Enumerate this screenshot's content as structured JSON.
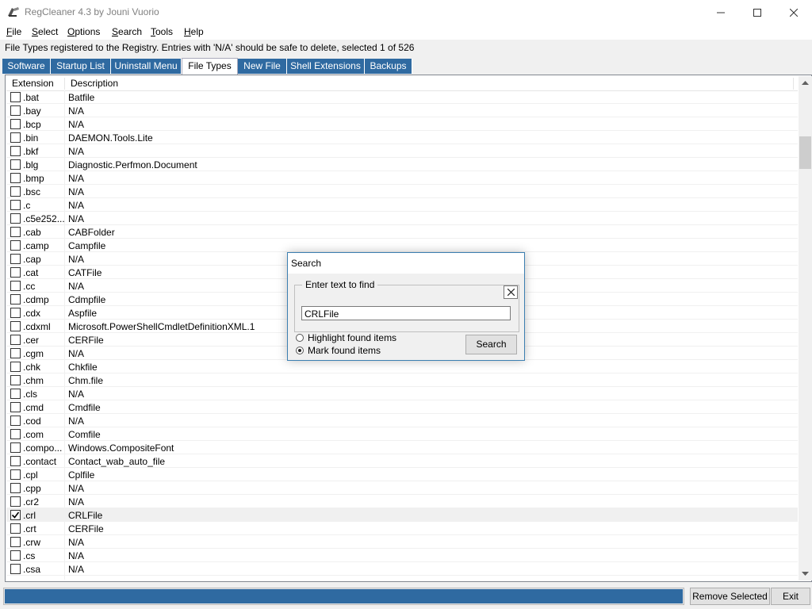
{
  "window": {
    "title": "RegCleaner 4.3 by Jouni Vuorio"
  },
  "menu": [
    {
      "first": "F",
      "rest": "ile"
    },
    {
      "first": "S",
      "rest": "elect"
    },
    {
      "first": "O",
      "rest": "ptions"
    },
    {
      "first": "S",
      "rest": "earch"
    },
    {
      "first": "T",
      "rest": "ools"
    },
    {
      "first": "H",
      "rest": "elp"
    }
  ],
  "status_text": "File Types registered to the Registry. Entries with 'N/A' should be safe to delete, selected 1 of 526",
  "tabs": [
    "Software",
    "Startup List",
    "Uninstall Menu",
    "File Types",
    "New File",
    "Shell Extensions",
    "Backups"
  ],
  "active_tab": "File Types",
  "table": {
    "columns": [
      "Extension",
      "Description"
    ],
    "rows": [
      {
        "ext": ".bat",
        "desc": "Batfile",
        "checked": false
      },
      {
        "ext": ".bay",
        "desc": "N/A",
        "checked": false
      },
      {
        "ext": ".bcp",
        "desc": "N/A",
        "checked": false
      },
      {
        "ext": ".bin",
        "desc": "DAEMON.Tools.Lite",
        "checked": false
      },
      {
        "ext": ".bkf",
        "desc": "N/A",
        "checked": false
      },
      {
        "ext": ".blg",
        "desc": "Diagnostic.Perfmon.Document",
        "checked": false
      },
      {
        "ext": ".bmp",
        "desc": "N/A",
        "checked": false
      },
      {
        "ext": ".bsc",
        "desc": "N/A",
        "checked": false
      },
      {
        "ext": ".c",
        "desc": "N/A",
        "checked": false
      },
      {
        "ext": ".c5e252...",
        "desc": "N/A",
        "checked": false
      },
      {
        "ext": ".cab",
        "desc": "CABFolder",
        "checked": false
      },
      {
        "ext": ".camp",
        "desc": "Campfile",
        "checked": false
      },
      {
        "ext": ".cap",
        "desc": "N/A",
        "checked": false
      },
      {
        "ext": ".cat",
        "desc": "CATFile",
        "checked": false
      },
      {
        "ext": ".cc",
        "desc": "N/A",
        "checked": false
      },
      {
        "ext": ".cdmp",
        "desc": "Cdmpfile",
        "checked": false
      },
      {
        "ext": ".cdx",
        "desc": "Aspfile",
        "checked": false
      },
      {
        "ext": ".cdxml",
        "desc": "Microsoft.PowerShellCmdletDefinitionXML.1",
        "checked": false
      },
      {
        "ext": ".cer",
        "desc": "CERFile",
        "checked": false
      },
      {
        "ext": ".cgm",
        "desc": "N/A",
        "checked": false
      },
      {
        "ext": ".chk",
        "desc": "Chkfile",
        "checked": false
      },
      {
        "ext": ".chm",
        "desc": "Chm.file",
        "checked": false
      },
      {
        "ext": ".cls",
        "desc": "N/A",
        "checked": false
      },
      {
        "ext": ".cmd",
        "desc": "Cmdfile",
        "checked": false
      },
      {
        "ext": ".cod",
        "desc": "N/A",
        "checked": false
      },
      {
        "ext": ".com",
        "desc": "Comfile",
        "checked": false
      },
      {
        "ext": ".compo...",
        "desc": "Windows.CompositeFont",
        "checked": false
      },
      {
        "ext": ".contact",
        "desc": "Contact_wab_auto_file",
        "checked": false
      },
      {
        "ext": ".cpl",
        "desc": "Cplfile",
        "checked": false
      },
      {
        "ext": ".cpp",
        "desc": "N/A",
        "checked": false
      },
      {
        "ext": ".cr2",
        "desc": "N/A",
        "checked": false
      },
      {
        "ext": ".crl",
        "desc": "CRLFile",
        "checked": true
      },
      {
        "ext": ".crt",
        "desc": "CERFile",
        "checked": false
      },
      {
        "ext": ".crw",
        "desc": "N/A",
        "checked": false
      },
      {
        "ext": ".cs",
        "desc": "N/A",
        "checked": false
      },
      {
        "ext": ".csa",
        "desc": "N/A",
        "checked": false
      }
    ]
  },
  "search_dialog": {
    "title": "Search",
    "group_label": "Enter text to find",
    "input_value": "CRLFile",
    "options": [
      {
        "label": "Highlight found items",
        "selected": false
      },
      {
        "label": "Mark found items",
        "selected": true
      }
    ],
    "search_label": "Search"
  },
  "footer": {
    "progress": 1.0,
    "remove_label": "Remove Selected",
    "exit_label": "Exit"
  },
  "colors": {
    "accent": "#2f6aa1",
    "dialog_border": "#3c7fb1"
  }
}
